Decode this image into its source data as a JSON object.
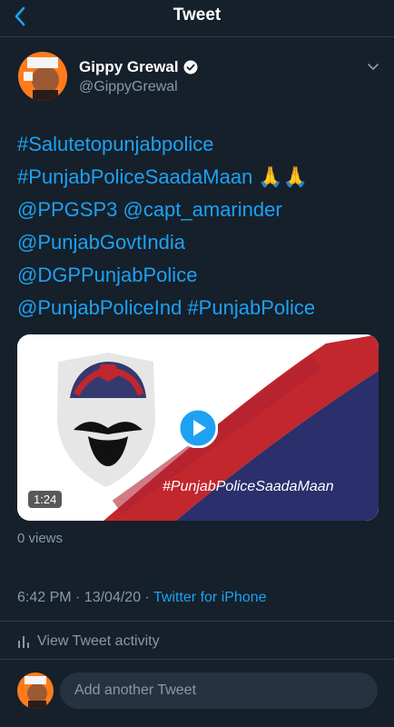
{
  "header": {
    "title": "Tweet",
    "back_icon": "back-icon",
    "color": "#1da1f2"
  },
  "tweet": {
    "author": {
      "name": "Gippy Grewal",
      "handle": "@GippyGrewal",
      "verified": true
    },
    "text_lines": [
      "#Salutetopunjabpolice",
      "#PunjabPoliceSaadaMaan 🙏🙏",
      "@PPGSP3 @capt_amarinder",
      "@PunjabGovtIndia",
      "@DGPPunjabPolice",
      "@PunjabPoliceInd #PunjabPolice"
    ],
    "media": {
      "duration": "1:24",
      "overlay_text": "#PunjabPoliceSaadaMaan"
    },
    "views": "0 views",
    "time": "6:42 PM · 13/04/20 · ",
    "source": "Twitter for iPhone",
    "activity_label": "View Tweet activity"
  },
  "reply": {
    "placeholder": "Add another Tweet"
  }
}
